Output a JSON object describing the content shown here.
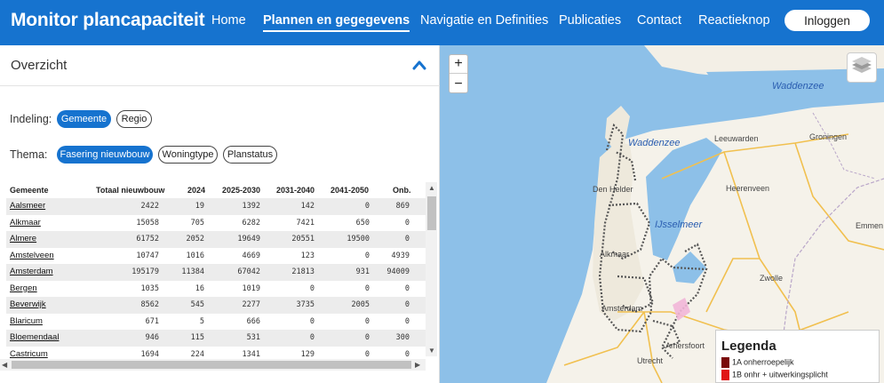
{
  "header": {
    "brand": "Monitor plancapaciteit",
    "nav": [
      {
        "label": "Home",
        "active": false
      },
      {
        "label": "Plannen en gegegevens",
        "active": true
      },
      {
        "label": "Navigatie en Definities",
        "active": false
      },
      {
        "label": "Publicaties",
        "active": false
      },
      {
        "label": "Contact",
        "active": false
      },
      {
        "label": "Reactieknop",
        "active": false
      }
    ],
    "login": "Inloggen"
  },
  "overview": {
    "title": "Overzicht",
    "indeling_label": "Indeling:",
    "indeling": [
      "Gemeente",
      "Regio"
    ],
    "thema_label": "Thema:",
    "thema": [
      "Fasering nieuwbouw",
      "Woningtype",
      "Planstatus"
    ]
  },
  "table": {
    "headers": [
      "Gemeente",
      "Totaal nieuwbouw",
      "2024",
      "2025-2030",
      "2031-2040",
      "2041-2050",
      "Onb."
    ],
    "rows": [
      [
        "Aalsmeer",
        "2422",
        "19",
        "1392",
        "142",
        "0",
        "869"
      ],
      [
        "Alkmaar",
        "15058",
        "705",
        "6282",
        "7421",
        "650",
        "0"
      ],
      [
        "Almere",
        "61752",
        "2052",
        "19649",
        "20551",
        "19500",
        "0"
      ],
      [
        "Amstelveen",
        "10747",
        "1016",
        "4669",
        "123",
        "0",
        "4939"
      ],
      [
        "Amsterdam",
        "195179",
        "11384",
        "67042",
        "21813",
        "931",
        "94009"
      ],
      [
        "Bergen",
        "1035",
        "16",
        "1019",
        "0",
        "0",
        "0"
      ],
      [
        "Beverwijk",
        "8562",
        "545",
        "2277",
        "3735",
        "2005",
        "0"
      ],
      [
        "Blaricum",
        "671",
        "5",
        "666",
        "0",
        "0",
        "0"
      ],
      [
        "Bloemendaal",
        "946",
        "115",
        "531",
        "0",
        "0",
        "300"
      ],
      [
        "Castricum",
        "1694",
        "224",
        "1341",
        "129",
        "0",
        "0"
      ]
    ]
  },
  "map": {
    "zoom_in": "+",
    "zoom_out": "−",
    "places": [
      "Waddenzee",
      "Waddenzee",
      "Leeuwarden",
      "Groningen",
      "Den Helder",
      "Heerenveen",
      "IJsselmeer",
      "Emmen",
      "Alkmaar",
      "Zwolle",
      "Amsterdam",
      "Amersfoort",
      "Utrecht"
    ],
    "legend": {
      "title": "Legenda",
      "items": [
        {
          "label": "1A onherroepelijk",
          "color": "#7a0b0b"
        },
        {
          "label": "1B onhr + uitwerkingsplicht",
          "color": "#e01616"
        }
      ]
    }
  }
}
